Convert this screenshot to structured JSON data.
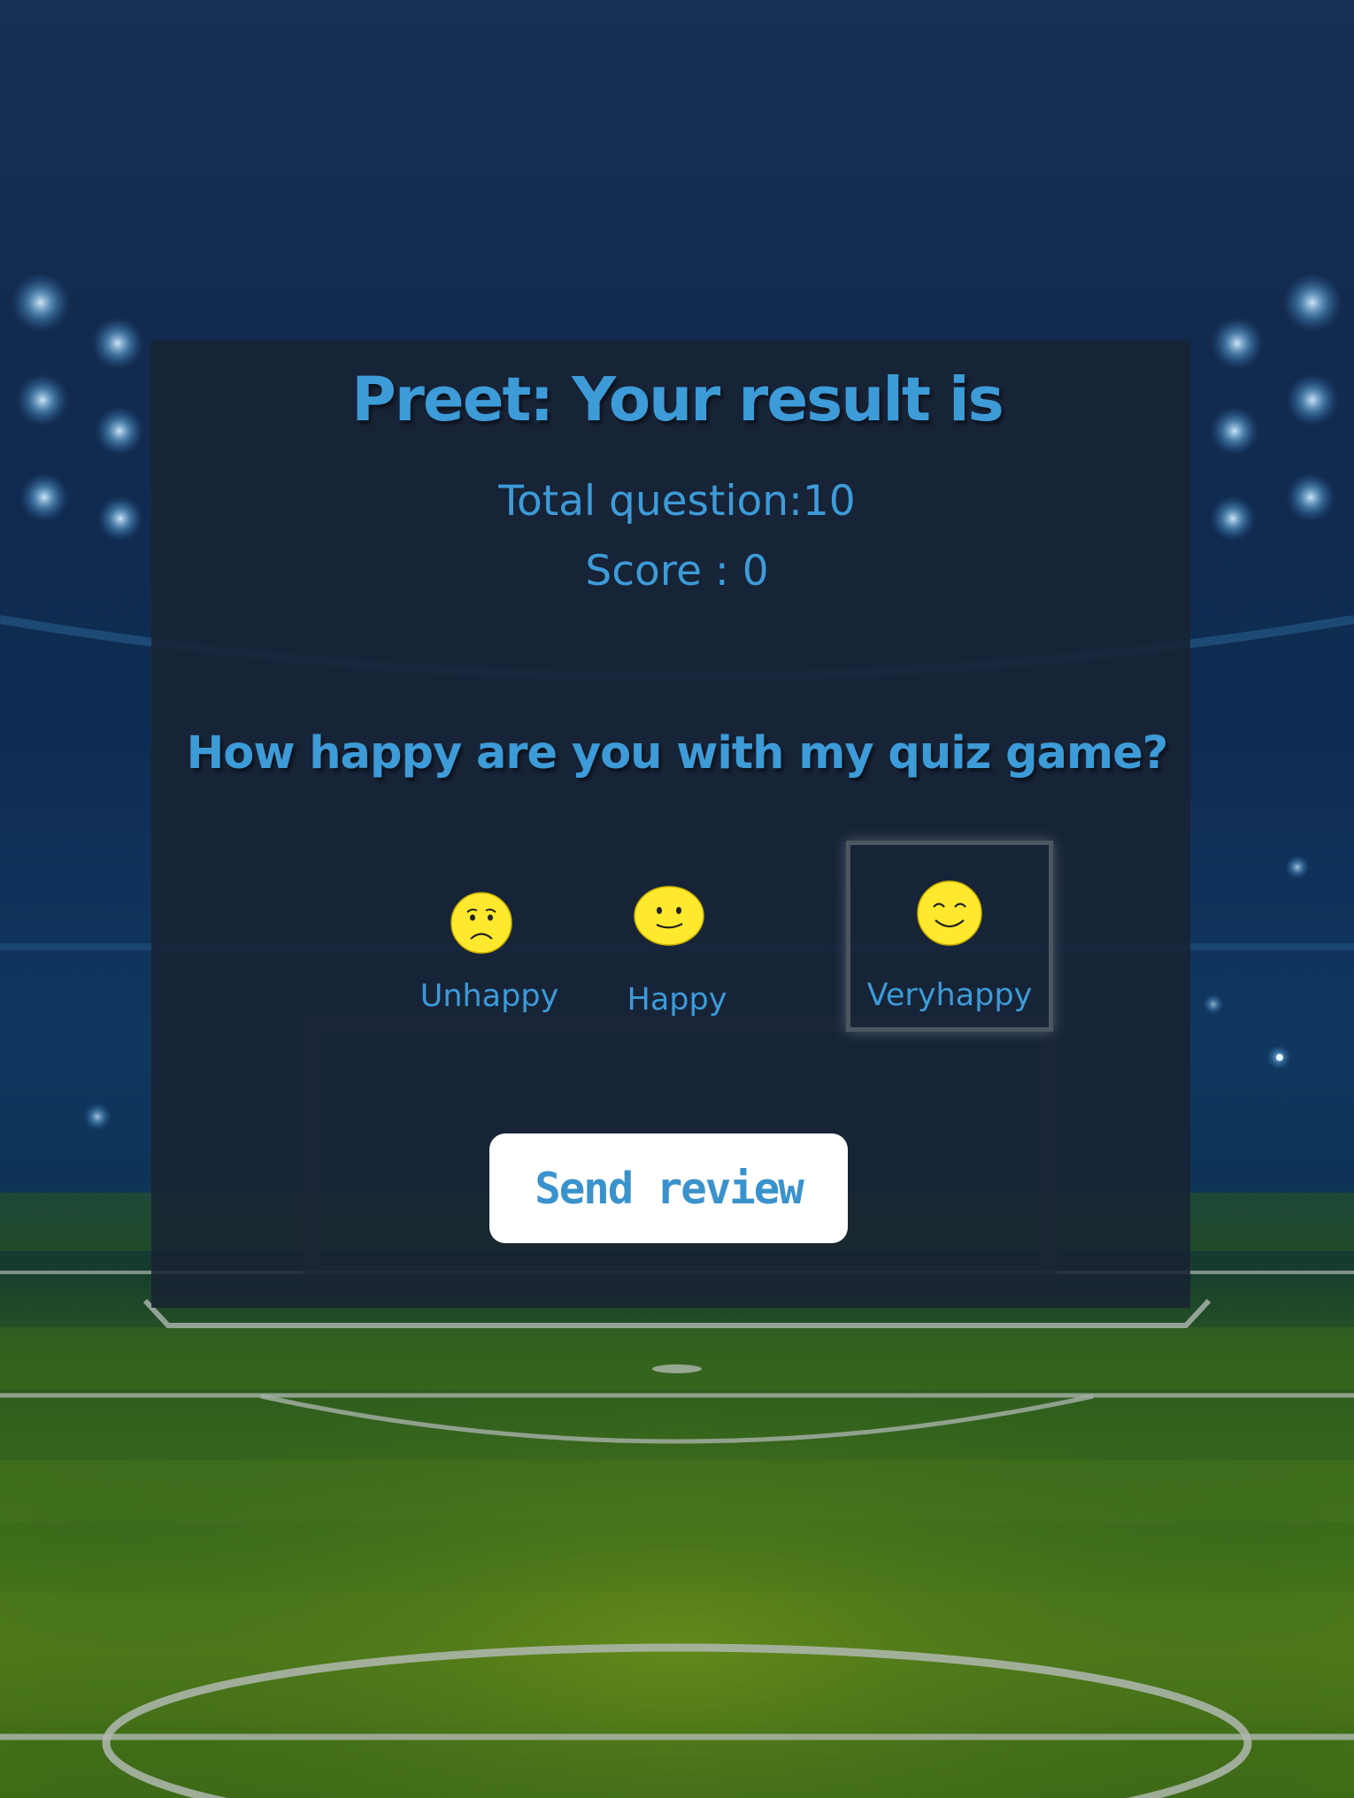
{
  "result": {
    "title": "Preet: Your result is",
    "total_question": "Total question:10",
    "score": "Score : 0"
  },
  "feedback": {
    "question": "How happy are you with my quiz game?",
    "options": [
      {
        "label": "Unhappy",
        "icon": "unhappy-face-icon"
      },
      {
        "label": "Happy",
        "icon": "happy-face-icon"
      },
      {
        "label": "Veryhappy",
        "icon": "very-happy-face-icon"
      }
    ],
    "selected": "Veryhappy"
  },
  "send_button": {
    "label": "Send review"
  },
  "colors": {
    "accent_text": "#3d9bd8",
    "panel": "#182232",
    "emoji": "#ffe92e",
    "button_bg": "#ffffff"
  }
}
